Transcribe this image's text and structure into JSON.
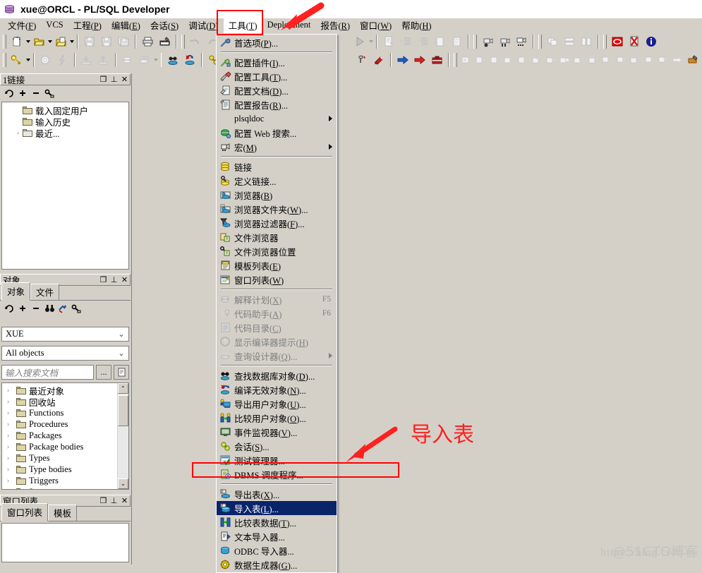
{
  "window": {
    "title": "xue@ORCL - PL/SQL Developer",
    "icon": "database-icon"
  },
  "menubar": {
    "items": [
      {
        "label": "文件(F)",
        "name": "menu-file",
        "active": false
      },
      {
        "label": "VCS",
        "name": "menu-vcs",
        "active": false
      },
      {
        "label": "工程(P)",
        "name": "menu-project",
        "active": false
      },
      {
        "label": "编辑(E)",
        "name": "menu-edit",
        "active": false
      },
      {
        "label": "会话(S)",
        "name": "menu-session",
        "active": false
      },
      {
        "label": "调试(D)",
        "name": "menu-debug",
        "active": false
      },
      {
        "label": "工具(T)",
        "name": "menu-tools",
        "active": true
      },
      {
        "label": "Deployment",
        "name": "menu-deployment",
        "active": false
      },
      {
        "label": "报告(R)",
        "name": "menu-report",
        "active": false
      },
      {
        "label": "窗口(W)",
        "name": "menu-window",
        "active": false
      },
      {
        "label": "帮助(H)",
        "name": "menu-help",
        "active": false
      }
    ]
  },
  "tools_menu": {
    "items": [
      {
        "label": "首选项(P)...",
        "icon": "wrench-icon",
        "name": "menuitem-preferences",
        "state": "enabled",
        "shortcut": "",
        "submenu": false,
        "separator_after": true
      },
      {
        "label": "配置插件(I)...",
        "icon": "plugin-icon",
        "name": "menuitem-configure-plugins",
        "state": "enabled",
        "shortcut": "",
        "submenu": false,
        "separator_after": false
      },
      {
        "label": "配置工具(T)...",
        "icon": "tools-icon",
        "name": "menuitem-configure-tools",
        "state": "enabled",
        "shortcut": "",
        "submenu": false,
        "separator_after": false
      },
      {
        "label": "配置文档(D)...",
        "icon": "document-icon",
        "name": "menuitem-configure-documents",
        "state": "enabled",
        "shortcut": "",
        "submenu": false,
        "separator_after": false
      },
      {
        "label": "配置报告(R)...",
        "icon": "report-icon",
        "name": "menuitem-configure-reports",
        "state": "enabled",
        "shortcut": "",
        "submenu": false,
        "separator_after": false
      },
      {
        "label": "plsqldoc",
        "icon": "",
        "name": "menuitem-plsqldoc",
        "state": "enabled",
        "shortcut": "",
        "submenu": true,
        "separator_after": false
      },
      {
        "label": "配置 Web 搜索...",
        "icon": "globe-icon",
        "name": "menuitem-configure-web-search",
        "state": "enabled",
        "shortcut": "",
        "submenu": false,
        "separator_after": false
      },
      {
        "label": "宏(M)",
        "icon": "macro-icon",
        "name": "menuitem-macro",
        "state": "enabled",
        "shortcut": "",
        "submenu": true,
        "separator_after": true
      },
      {
        "label": "链接",
        "icon": "database-icon",
        "name": "menuitem-connections",
        "state": "enabled",
        "shortcut": "",
        "submenu": false,
        "separator_after": false
      },
      {
        "label": "定义链接...",
        "icon": "define-connection-icon",
        "name": "menuitem-define-connection",
        "state": "enabled",
        "shortcut": "",
        "submenu": false,
        "separator_after": false
      },
      {
        "label": "浏览器(B)",
        "icon": "browser-icon",
        "name": "menuitem-browser",
        "state": "enabled",
        "shortcut": "",
        "submenu": false,
        "separator_after": false
      },
      {
        "label": "浏览器文件夹(W)...",
        "icon": "browser-folder-icon",
        "name": "menuitem-browser-folders",
        "state": "enabled",
        "shortcut": "",
        "submenu": false,
        "separator_after": false
      },
      {
        "label": "浏览器过滤器(F)...",
        "icon": "browser-filter-icon",
        "name": "menuitem-browser-filters",
        "state": "enabled",
        "shortcut": "",
        "submenu": false,
        "separator_after": false
      },
      {
        "label": "文件浏览器",
        "icon": "file-browser-icon",
        "name": "menuitem-file-browser",
        "state": "enabled",
        "shortcut": "",
        "submenu": false,
        "separator_after": false
      },
      {
        "label": "文件浏览器位置",
        "icon": "file-browser-location-icon",
        "name": "menuitem-file-browser-locations",
        "state": "enabled",
        "shortcut": "",
        "submenu": false,
        "separator_after": false
      },
      {
        "label": "模板列表(E)",
        "icon": "template-list-icon",
        "name": "menuitem-template-list",
        "state": "enabled",
        "shortcut": "",
        "submenu": false,
        "separator_after": false
      },
      {
        "label": "窗口列表(W)",
        "icon": "window-list-icon",
        "name": "menuitem-window-list",
        "state": "enabled",
        "shortcut": "",
        "submenu": false,
        "separator_after": true
      },
      {
        "label": "解释计划(X)",
        "icon": "explain-plan-icon",
        "name": "menuitem-explain-plan",
        "state": "disabled",
        "shortcut": "F5",
        "submenu": false,
        "separator_after": false
      },
      {
        "label": "代码助手(A)",
        "icon": "code-assistant-icon",
        "name": "menuitem-code-assistant",
        "state": "disabled",
        "shortcut": "F6",
        "submenu": false,
        "separator_after": false
      },
      {
        "label": "代码目录(C)",
        "icon": "code-contents-icon",
        "name": "menuitem-code-contents",
        "state": "disabled",
        "shortcut": "",
        "submenu": false,
        "separator_after": false
      },
      {
        "label": "显示编译器提示(H)",
        "icon": "compiler-hints-icon",
        "name": "menuitem-compiler-hints",
        "state": "disabled",
        "shortcut": "",
        "submenu": false,
        "separator_after": false
      },
      {
        "label": "查询设计器(Q)...",
        "icon": "query-builder-icon",
        "name": "menuitem-query-builder",
        "state": "disabled",
        "shortcut": "",
        "submenu": true,
        "separator_after": true
      },
      {
        "label": "查找数据库对象(D)...",
        "icon": "find-db-object-icon",
        "name": "menuitem-find-database-objects",
        "state": "enabled",
        "shortcut": "",
        "submenu": false,
        "separator_after": false
      },
      {
        "label": "编译无效对象(N)...",
        "icon": "compile-invalid-icon",
        "name": "menuitem-compile-invalid-objects",
        "state": "enabled",
        "shortcut": "",
        "submenu": false,
        "separator_after": false
      },
      {
        "label": "导出用户对象(U)...",
        "icon": "export-user-objects-icon",
        "name": "menuitem-export-user-objects",
        "state": "enabled",
        "shortcut": "",
        "submenu": false,
        "separator_after": false
      },
      {
        "label": "比较用户对象(O)...",
        "icon": "compare-user-objects-icon",
        "name": "menuitem-compare-user-objects",
        "state": "enabled",
        "shortcut": "",
        "submenu": false,
        "separator_after": false
      },
      {
        "label": "事件监视器(V)...",
        "icon": "event-monitor-icon",
        "name": "menuitem-event-monitor",
        "state": "enabled",
        "shortcut": "",
        "submenu": false,
        "separator_after": false
      },
      {
        "label": "会话(S)...",
        "icon": "sessions-icon",
        "name": "menuitem-sessions",
        "state": "enabled",
        "shortcut": "",
        "submenu": false,
        "separator_after": false
      },
      {
        "label": "测试管理器...",
        "icon": "test-manager-icon",
        "name": "menuitem-test-manager",
        "state": "enabled",
        "shortcut": "",
        "submenu": false,
        "separator_after": false
      },
      {
        "label": "DBMS 调度程序...",
        "icon": "dbms-scheduler-icon",
        "name": "menuitem-dbms-scheduler",
        "state": "enabled",
        "shortcut": "",
        "submenu": false,
        "separator_after": true
      },
      {
        "label": "导出表(X)...",
        "icon": "export-tables-icon",
        "name": "menuitem-export-tables",
        "state": "enabled",
        "shortcut": "",
        "submenu": false,
        "separator_after": false
      },
      {
        "label": "导入表(L)...",
        "icon": "import-tables-icon",
        "name": "menuitem-import-tables",
        "state": "highlighted",
        "shortcut": "",
        "submenu": false,
        "separator_after": false
      },
      {
        "label": "比较表数据(T)...",
        "icon": "compare-table-data-icon",
        "name": "menuitem-compare-table-data",
        "state": "enabled",
        "shortcut": "",
        "submenu": false,
        "separator_after": false
      },
      {
        "label": "文本导入器...",
        "icon": "text-importer-icon",
        "name": "menuitem-text-importer",
        "state": "enabled",
        "shortcut": "",
        "submenu": false,
        "separator_after": false
      },
      {
        "label": "ODBC 导入器...",
        "icon": "odbc-importer-icon",
        "name": "menuitem-odbc-importer",
        "state": "enabled",
        "shortcut": "",
        "submenu": false,
        "separator_after": false
      },
      {
        "label": "数据生成器(G)...",
        "icon": "data-generator-icon",
        "name": "menuitem-data-generator",
        "state": "enabled",
        "shortcut": "",
        "submenu": false,
        "separator_after": false
      }
    ]
  },
  "connections_panel": {
    "title": "1链接",
    "buttons": {
      "restore": "❐",
      "pin": "⊥",
      "close": "✕"
    },
    "toolbar": [
      "refresh-icon",
      "add-icon",
      "remove-icon",
      "key-icon"
    ],
    "tree": [
      {
        "label": "载入固定用户",
        "expander": "",
        "icon": "folder-icon"
      },
      {
        "label": "输入历史",
        "expander": "",
        "icon": "folder-icon"
      },
      {
        "label": "最近...",
        "expander": "›",
        "icon": "folder-gray-icon"
      }
    ]
  },
  "objects_panel": {
    "title": "对象",
    "buttons": {
      "restore": "❐",
      "pin": "⊥",
      "close": "✕"
    },
    "tabs": [
      {
        "label": "对象",
        "selected": true
      },
      {
        "label": "文件",
        "selected": false
      }
    ],
    "toolbar": [
      "refresh-icon",
      "add-icon",
      "remove-icon",
      "binoculars-icon",
      "filter-icon",
      "key-icon"
    ],
    "owner_select": {
      "value": "XUE",
      "arrow": "⌄"
    },
    "type_select": {
      "value": "All objects",
      "arrow": "⌄"
    },
    "search": {
      "placeholder": "输入搜索文档",
      "value": "",
      "more_button": "...",
      "doc_button": "▤"
    },
    "tree": [
      {
        "label": "最近对象",
        "expander": "›"
      },
      {
        "label": "回收站",
        "expander": "›"
      },
      {
        "label": "Functions",
        "expander": "›"
      },
      {
        "label": "Procedures",
        "expander": "›"
      },
      {
        "label": "Packages",
        "expander": "›"
      },
      {
        "label": "Package bodies",
        "expander": "›"
      },
      {
        "label": "Types",
        "expander": "›"
      },
      {
        "label": "Type bodies",
        "expander": "›"
      },
      {
        "label": "Triggers",
        "expander": "›"
      },
      {
        "label": "Java sources",
        "expander": "›"
      }
    ],
    "scrollbar": {
      "up": "⌃",
      "down": "⌄"
    }
  },
  "windows_panel": {
    "title": "窗口列表",
    "buttons": {
      "restore": "❐",
      "pin": "⊥",
      "close": "✕"
    },
    "tabs": [
      {
        "label": "窗口列表",
        "selected": true
      },
      {
        "label": "模板",
        "selected": false
      }
    ]
  },
  "annotations": {
    "import_label": "导入表",
    "color": "#ff0000"
  },
  "watermark": {
    "url": "https://blog.csdn.ne",
    "brand": "@51CTO博客"
  }
}
